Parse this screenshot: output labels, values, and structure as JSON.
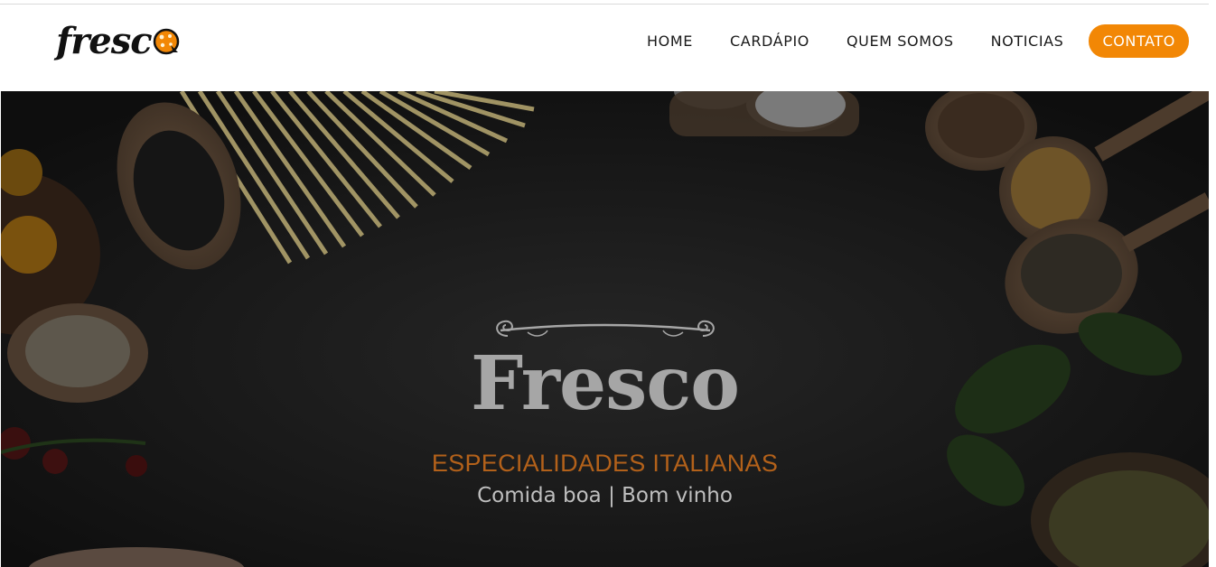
{
  "header": {
    "logo_text": "fresc",
    "nav": [
      {
        "label": "HOME"
      },
      {
        "label": "CARDÁPIO"
      },
      {
        "label": "QUEM SOMOS"
      },
      {
        "label": "NOTICIAS"
      }
    ],
    "cta_label": "CONTATO"
  },
  "hero": {
    "title": "Fresco",
    "subtitle": "ESPECIALIDADES ITALIANAS",
    "tagline": "Comida boa | Bom vinho"
  },
  "colors": {
    "accent": "#f28705",
    "hero_bg": "#141414",
    "subtitle": "#b3611a",
    "title": "#a6a6a6"
  },
  "icons": [
    "pizza-logo-icon",
    "ornament-divider-icon"
  ]
}
